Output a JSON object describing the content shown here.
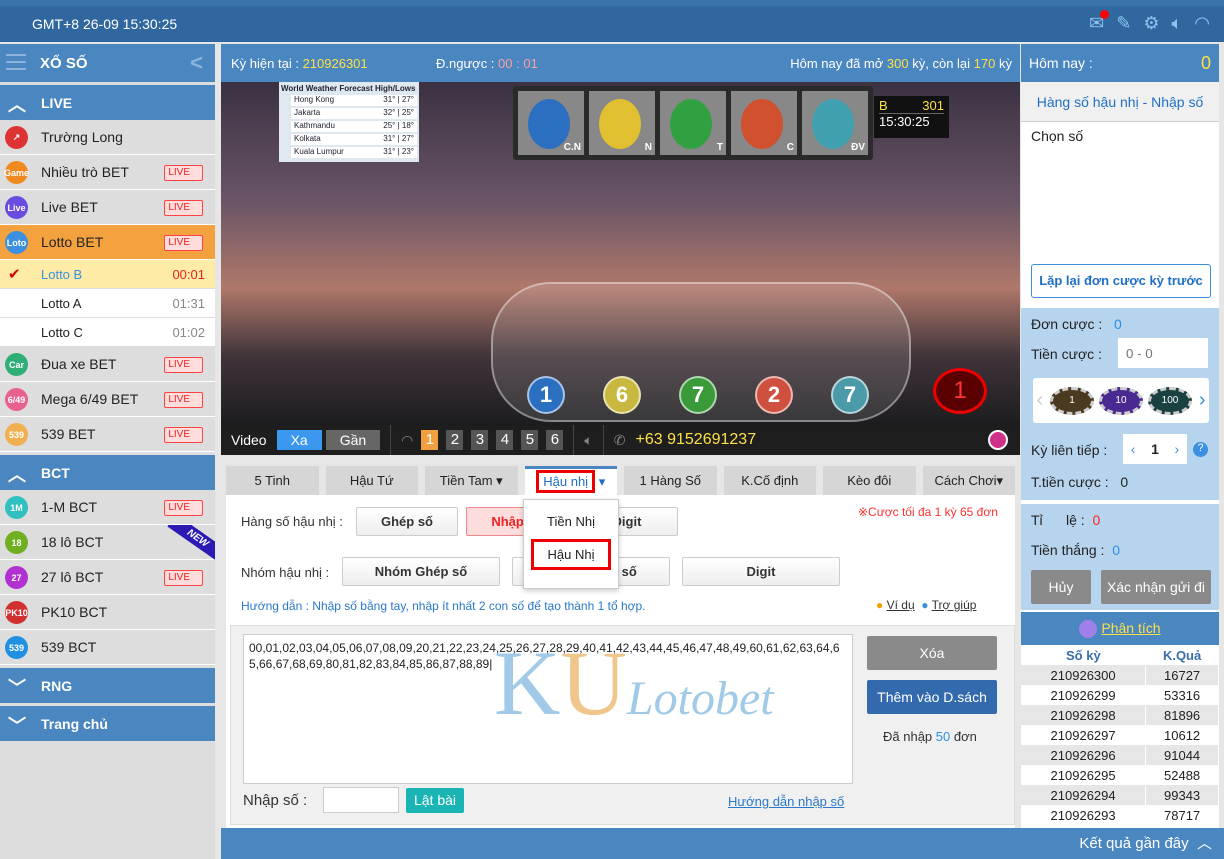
{
  "topbar": {
    "clock": "GMT+8 26-09 15:30:25",
    "icons": [
      "mail-icon",
      "tools-icon",
      "gear-icon",
      "speaker-icon",
      "wifi-icon"
    ]
  },
  "sidebar": {
    "title": "XỔ SỐ",
    "live": {
      "label": "LIVE",
      "items": [
        {
          "label": "Trường Long",
          "icon": "↗",
          "color": "#d33",
          "live": false
        },
        {
          "label": "Nhiều trò BET",
          "icon": "Game",
          "color": "#f08a20",
          "live": true
        },
        {
          "label": "Live BET",
          "icon": "Live",
          "color": "#6a4ce0",
          "live": true
        },
        {
          "label": "Lotto BET",
          "icon": "Loto",
          "color": "#3d8fe0",
          "live": true
        }
      ],
      "sub": [
        {
          "label": "Lotto B",
          "time": "00:01"
        },
        {
          "label": "Lotto A",
          "time": "01:31"
        },
        {
          "label": "Lotto C",
          "time": "01:02"
        }
      ],
      "items2": [
        {
          "label": "Đua xe BET",
          "icon": "Car",
          "color": "#2fae78",
          "live": true
        },
        {
          "label": "Mega 6/49 BET",
          "icon": "6/49",
          "color": "#e86090",
          "live": true
        },
        {
          "label": "539 BET",
          "icon": "539",
          "color": "#f0b050",
          "live": true
        }
      ]
    },
    "bct": {
      "label": "BCT",
      "items": [
        {
          "label": "1-M BCT",
          "icon": "1M",
          "color": "#30c0c0",
          "live": true
        },
        {
          "label": "18 lô BCT",
          "icon": "18",
          "color": "#70b020",
          "live": false
        },
        {
          "label": "27 lô BCT",
          "icon": "27",
          "color": "#b030d0",
          "live": true
        },
        {
          "label": "PK10 BCT",
          "icon": "PK10",
          "color": "#d03030",
          "live": false
        },
        {
          "label": "539 BCT",
          "icon": "539",
          "color": "#2090e0",
          "live": false
        }
      ]
    },
    "new_badge": "NEW",
    "live_badge": "LIVE",
    "rng": "RNG",
    "home": "Trang chủ"
  },
  "header": {
    "ky_label": "Kỳ hiện tại  :",
    "ky": "210926301",
    "dn_label": "Đ.ngược :",
    "dn": "00 : 01",
    "today_a": "Hôm nay đã mở",
    "opened": "300",
    "today_b": "kỳ, còn lại",
    "left": "170",
    "today_c": "kỳ"
  },
  "video": {
    "weather_title": "World Weather  Forecast High/Lows",
    "weather": [
      [
        "Hong Kong",
        "31° | 27°"
      ],
      [
        "Jakarta",
        "32° | 25°"
      ],
      [
        "Kathmandu",
        "25° | 18°"
      ],
      [
        "Kolkata",
        "31° | 27°"
      ],
      [
        "Kuala Lumpur",
        "31° | 23°"
      ]
    ],
    "tiles": [
      {
        "label": "C.N",
        "color": "#2a6fc0"
      },
      {
        "label": "N",
        "color": "#e0c030"
      },
      {
        "label": "T",
        "color": "#30a040"
      },
      {
        "label": "C",
        "color": "#d05030"
      },
      {
        "label": "ĐV",
        "color": "#40a0b0"
      }
    ],
    "room": "B",
    "period": "301",
    "time": "15:30:25",
    "balls": [
      {
        "n": "1",
        "c": "#2a6fc0"
      },
      {
        "n": "6",
        "c": "#c8b840"
      },
      {
        "n": "7",
        "c": "#3a9a3a"
      },
      {
        "n": "2",
        "c": "#d05040"
      },
      {
        "n": "7",
        "c": "#4a9aa8"
      }
    ],
    "big_ball": "1",
    "controls": {
      "video": "Video",
      "far": "Xa",
      "near": "Gần",
      "cams": [
        "1",
        "2",
        "3",
        "4",
        "5",
        "6"
      ],
      "active_cam": "1",
      "phone": "+63 9152691237"
    }
  },
  "tabs": [
    {
      "label": "5 Tinh"
    },
    {
      "label": "Hậu Tứ"
    },
    {
      "label": "Tiền Tam ▾"
    },
    {
      "label": "Hậu nhị",
      "active": true
    },
    {
      "label": "1 Hàng Số"
    },
    {
      "label": "K.Cố định"
    },
    {
      "label": "Kèo đôi"
    },
    {
      "label": "Cách Chơi▾"
    }
  ],
  "dropdown": [
    "Tiền Nhị",
    "Hậu Nhị"
  ],
  "form": {
    "row1_label": "Hàng số hậu nhị :",
    "row1": [
      "Ghép số",
      "Nhập số",
      "Digit"
    ],
    "row2_label": "Nhóm hậu nhị :",
    "row2": [
      "Nhóm Ghép số",
      "Nhóm Nhập số",
      "Digit"
    ],
    "max_note": "※Cược tối đa 1 kỳ 65 đơn",
    "guide": "Hướng dẫn : Nhập số bằng tay, nhập ít nhất 2 con số để tạo thành 1 tổ hợp.",
    "example": "Ví dụ",
    "help": "Trợ giúp",
    "numbers": "00,01,02,03,04,05,06,07,08,09,20,21,22,23,24,25,26,27,28,29,40,41,42,43,44,45,46,47,48,49,60,61,62,63,64,65,66,67,68,69,80,81,82,83,84,85,86,87,88,89",
    "clear": "Xóa",
    "add": "Thêm vào D.sách",
    "entered_a": "Đã nhập",
    "entered": "50",
    "entered_b": "đơn",
    "input_label": "Nhập số :",
    "input_value": "",
    "flip": "Lật bài",
    "input_guide": "Hướng dẫn nhập số",
    "watermark_k": "K",
    "watermark_u": "U",
    "watermark_s": "Lotobet"
  },
  "right": {
    "today_label": "Hôm nay :",
    "today": "0",
    "subtitle": "Hàng số hậu nhị - Nhập số",
    "choose": "Chọn số",
    "repeat": "Lặp lại đơn cược kỳ trước",
    "orders_label": "Đơn cược :",
    "orders": "0",
    "amount_label": "Tiền cược :",
    "amount_placeholder": "0 - 0",
    "chips": [
      {
        "v": "1",
        "c": "#4a3a20"
      },
      {
        "v": "10",
        "c": "#4a2a90"
      },
      {
        "v": "100",
        "c": "#1a4040"
      }
    ],
    "consec_label": "Kỳ liên tiếp :",
    "consec": "1",
    "total_label": "T.tiền cược :",
    "total": "0",
    "rate_label": "Tỉ      lệ :",
    "rate": "0",
    "win_label": "Tiền thắng :",
    "win": "0",
    "cancel": "Hủy",
    "confirm": "Xác nhận gửi đi",
    "analysis": "Phân tích",
    "cols": [
      "Số kỳ",
      "K.Quả"
    ],
    "results": [
      [
        "210926300",
        "16727"
      ],
      [
        "210926299",
        "53316"
      ],
      [
        "210926298",
        "81896"
      ],
      [
        "210926297",
        "10612"
      ],
      [
        "210926296",
        "91044"
      ],
      [
        "210926295",
        "52488"
      ],
      [
        "210926294",
        "99343"
      ],
      [
        "210926293",
        "78717"
      ]
    ]
  },
  "footer": {
    "recent": "Kết quả gần đây"
  }
}
